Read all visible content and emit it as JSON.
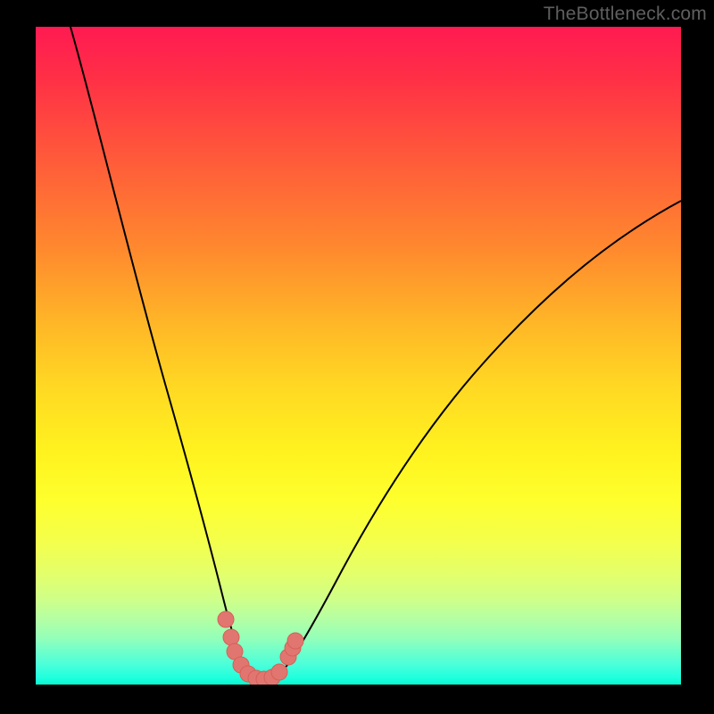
{
  "watermark": "TheBottleneck.com",
  "chart_data": {
    "type": "line",
    "title": "",
    "xlabel": "",
    "ylabel": "",
    "xlim": [
      0,
      100
    ],
    "ylim": [
      0,
      100
    ],
    "grid": false,
    "legend": false,
    "series": [
      {
        "name": "curve",
        "x": [
          5,
          8,
          12,
          16,
          20,
          24,
          26,
          28,
          30,
          31,
          32,
          33,
          34,
          35,
          36,
          38,
          40,
          44,
          50,
          58,
          68,
          80,
          92,
          100
        ],
        "y": [
          100,
          89,
          75,
          61,
          46,
          30,
          22,
          14,
          6,
          3,
          1,
          0,
          0,
          0,
          1,
          3,
          7,
          15,
          27,
          40,
          52,
          62,
          69,
          73
        ]
      },
      {
        "name": "markers",
        "x": [
          28.5,
          29.5,
          30.5,
          31.5,
          32.5,
          33.5,
          34.5,
          35.5,
          36.5,
          37.5,
          38
        ],
        "y": [
          9,
          6,
          3,
          1.2,
          0.5,
          0.3,
          0.5,
          1.2,
          3,
          6,
          7.5
        ]
      }
    ],
    "colors": {
      "curve": "#000000",
      "marker_fill": "#e0766f",
      "marker_stroke": "#d85f59"
    }
  }
}
